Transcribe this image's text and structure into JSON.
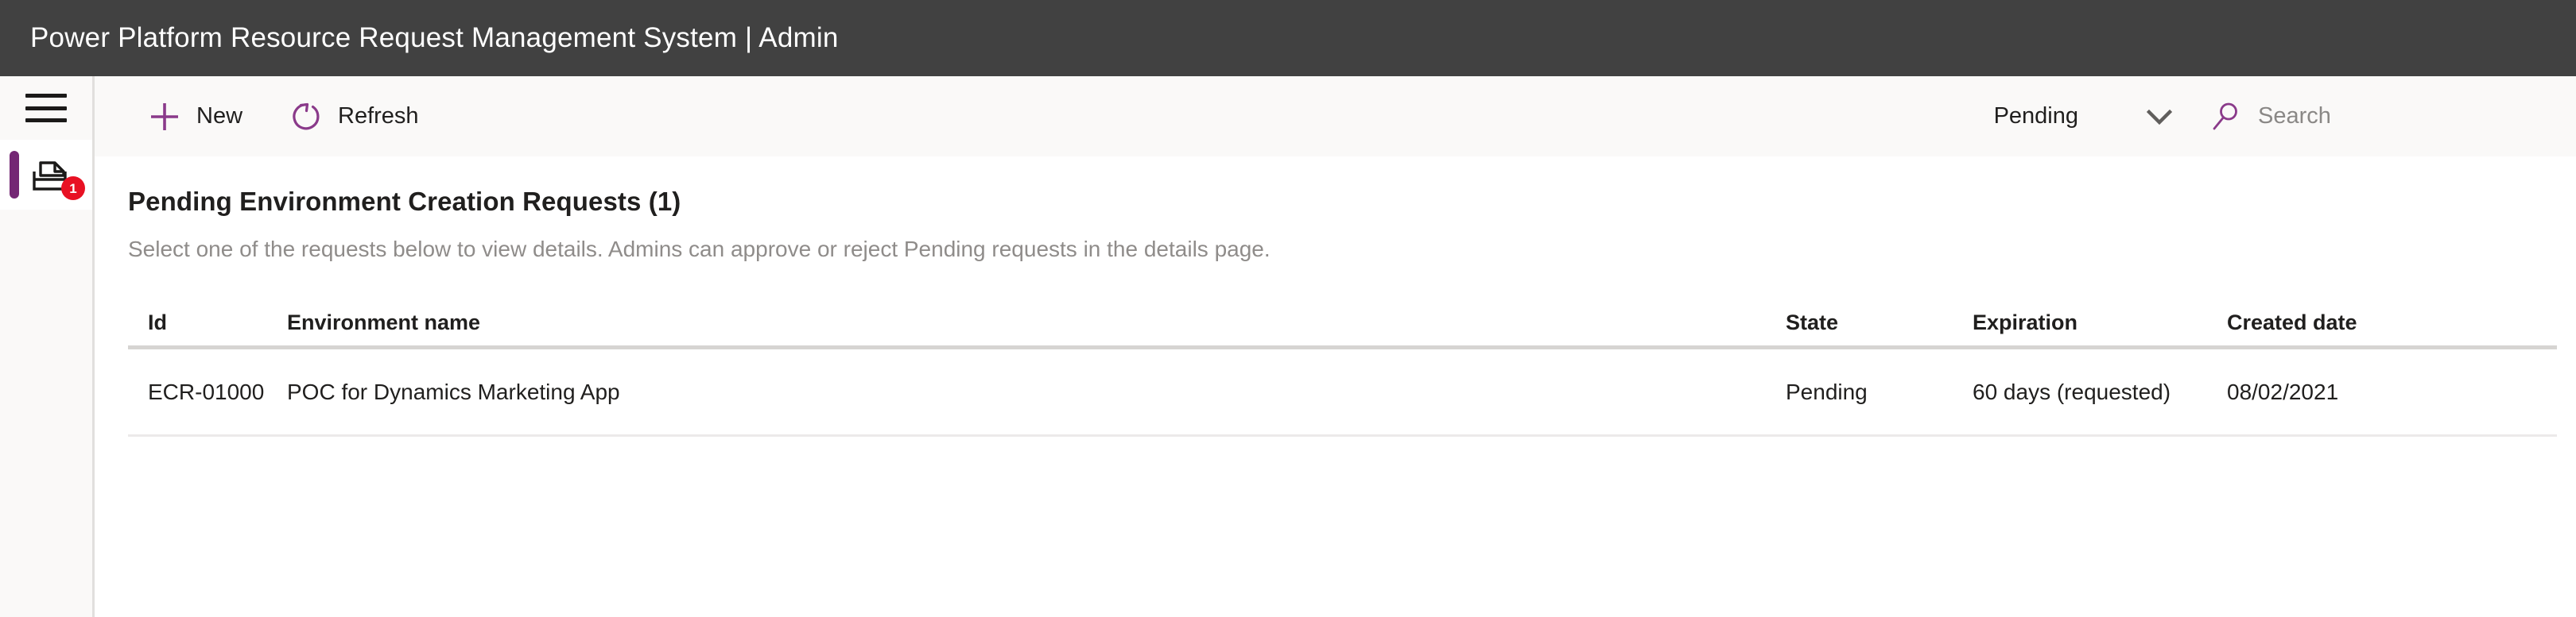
{
  "titlebar": {
    "title": "Power Platform Resource Request Management System | Admin"
  },
  "rail": {
    "menu_icon": "hamburger-icon",
    "items": [
      {
        "icon": "inbox-icon",
        "badge": "1",
        "selected": true
      }
    ]
  },
  "commandbar": {
    "new_label": "New",
    "new_icon": "plus-icon",
    "refresh_label": "Refresh",
    "refresh_icon": "refresh-icon",
    "filter_value": "Pending",
    "filter_icon": "chevron-down-icon",
    "search_icon": "search-icon",
    "search_value": "",
    "search_placeholder": "Search"
  },
  "page": {
    "title": "Pending Environment Creation Requests (1)",
    "subtitle": "Select one of the requests below to view details. Admins can approve or reject Pending requests in the details page."
  },
  "table": {
    "columns": [
      "Id",
      "Environment name",
      "State",
      "Expiration",
      "Created date"
    ],
    "rows": [
      {
        "id": "ECR-01000",
        "environment_name": "POC for Dynamics Marketing App",
        "state": "Pending",
        "expiration": "60 days (requested)",
        "created_date": "08/02/2021"
      }
    ]
  },
  "colors": {
    "titlebar_bg": "#414141",
    "accent_purple": "#742774",
    "badge_red": "#e81123",
    "chrome_bg": "#faf9f8",
    "border": "#e1dfdd",
    "text_primary": "#201f1e",
    "text_secondary": "#8f8c8a"
  }
}
